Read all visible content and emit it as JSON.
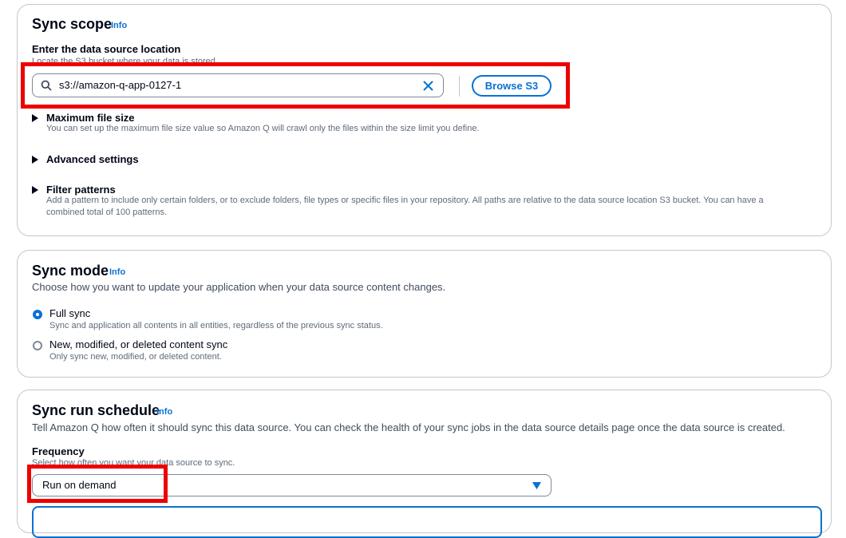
{
  "sync_scope": {
    "title": "Sync scope",
    "info": "Info",
    "location_label": "Enter the data source location",
    "location_desc": "Locate the S3 bucket where your data is stored",
    "location_value": "s3://amazon-q-app-0127-1",
    "browse_label": "Browse S3",
    "max_file": {
      "title": "Maximum file size",
      "desc": "You can set up the maximum file size value so Amazon Q will crawl only the files within the size limit you define."
    },
    "advanced": {
      "title": "Advanced settings"
    },
    "filter": {
      "title": "Filter patterns",
      "desc_line1": "Add a pattern to include only certain folders, or to exclude folders, file types or specific files in your repository. All paths are relative to the data source location S3 bucket. You can have a",
      "desc_line2": "combined total of 100 patterns."
    }
  },
  "sync_mode": {
    "title": "Sync mode",
    "info": "Info",
    "desc": "Choose how you want to update your application when your data source content changes.",
    "options": [
      {
        "label": "Full sync",
        "desc": "Sync and application all contents in all entities, regardless of the previous sync status.",
        "selected": true
      },
      {
        "label": "New, modified, or deleted content sync",
        "desc": "Only sync new, modified, or deleted content.",
        "selected": false
      }
    ]
  },
  "sync_schedule": {
    "title": "Sync run schedule",
    "info": "Info",
    "desc": "Tell Amazon Q how often it should sync this data source. You can check the health of your sync jobs in the data source details page once the data source is created.",
    "frequency_label": "Frequency",
    "frequency_desc": "Select how often you want your data source to sync.",
    "frequency_value": "Run on demand"
  },
  "colors": {
    "accent": "#0972d3",
    "highlight": "#ee0000",
    "border": "#c6c6cd"
  }
}
